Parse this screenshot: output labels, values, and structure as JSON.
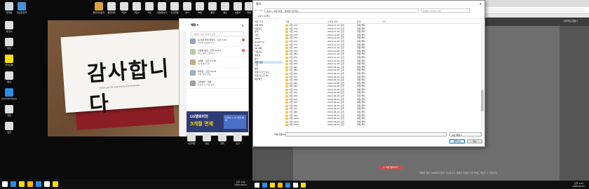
{
  "left_desktop": {
    "icons_top": [
      {
        "label": "휴지통",
        "color": "#cfd8dc"
      },
      {
        "label": "리모트한국",
        "color": "#4a90d9"
      },
      {
        "label": "확인미인문자",
        "color": "#d9a441"
      },
      {
        "label": "통합미래",
        "color": "#e0e0e0"
      },
      {
        "label": "자료1",
        "color": "#e0e0e0"
      },
      {
        "label": "자료2",
        "color": "#e0e0e0"
      },
      {
        "label": "시트",
        "color": "#e0e0e0"
      },
      {
        "label": "정보접속기",
        "color": "#e0e0e0"
      },
      {
        "label": "신규파일",
        "color": "#e0e0e0"
      },
      {
        "label": "문서",
        "color": "#e0e0e0"
      },
      {
        "label": "엑셀",
        "color": "#e0e0e0"
      },
      {
        "label": "통합",
        "color": "#e0e0e0"
      },
      {
        "label": "메모",
        "color": "#e0e0e0"
      },
      {
        "label": "새문서",
        "color": "#e0e0e0"
      },
      {
        "label": "파일",
        "color": "#e0e0e0"
      }
    ],
    "icons_left": [
      {
        "label": "새 문서",
        "color": "#e0e0e0"
      },
      {
        "label": "파일",
        "color": "#e0e0e0"
      },
      {
        "label": "카카오톡",
        "color": "#f9e000"
      },
      {
        "label": "알씨",
        "color": "#e0e0e0"
      },
      {
        "label": "Internet Explorer",
        "color": "#2d8ce5"
      },
      {
        "label": "자료",
        "color": "#e0e0e0"
      },
      {
        "label": "보관",
        "color": "#e0e0e0"
      }
    ],
    "icons_bottom": [
      {
        "label": "사진작업"
      },
      {
        "label": "영상"
      },
      {
        "label": "압축"
      },
      {
        "label": "보관"
      }
    ],
    "wallpaper": {
      "main_text": "감사합니다",
      "sub_text": "thank you for your heart and kindness"
    },
    "taskbar": {
      "time": "오후 1:01",
      "date": "2020-06-01",
      "icons": [
        "#ffffff",
        "#2d8ce5",
        "#f9e000",
        "#ffb900",
        "#2d8ce5",
        "#ffffff",
        "#f9e000"
      ]
    }
  },
  "messenger": {
    "title": "채팅 ▾",
    "search_placeholder": "채팅방 이름, 참여자 검색",
    "rows": [
      {
        "name": "김 비서 업무 담당자",
        "snippet": "사진을 보냈습니다.",
        "time": "오후 1:00",
        "badge": "1",
        "color": "#8aa4c8"
      },
      {
        "name": "홍길동 팀장",
        "snippet": "확인 부탁 드립니다",
        "time": "오후 12:54",
        "badge": "2",
        "color": "#b7c9a8"
      },
      {
        "name": "이대리",
        "snippet": "네 알겠습니다",
        "time": "오전 11:20",
        "badge": "",
        "color": "#c8a98a"
      },
      {
        "name": "박과장",
        "snippet": "파일 전송 완료",
        "time": "오전 10:05",
        "badge": "",
        "color": "#9ab0c0"
      },
      {
        "name": "고객센터",
        "snippet": "문의하신 내용 답변",
        "time": "어제",
        "badge": "",
        "color": "#a0a0a0"
      }
    ],
    "ad": {
      "line1": "LG헬로비전",
      "line2": "3개월 면제",
      "detail": "인터넷 + TV 최대 혜택"
    }
  },
  "browser": {
    "tab_title": "관리자 페이지",
    "url": "관리자 페이지 주소",
    "header_user": "관리자님 환영 ▾",
    "action_button": "+ 파일 첨부하기",
    "note": "파일은 최대 10MB까지 첨부 가능합니다. 첨부한 파일은 수정 후에도 확인할 수 있습니다."
  },
  "file_dialog": {
    "title": "열기",
    "close": "✕",
    "path": "내 PC › 바탕 화면 › 휴대폰사진자료 ›",
    "search_placeholder": "휴대폰사진자료 검색",
    "toolbar": "구성 ▾   새 폴더",
    "tree": [
      {
        "label": "바로 가기",
        "sel": false
      },
      {
        "label": "바탕 화면",
        "sel": false
      },
      {
        "label": "다운로드",
        "sel": false
      },
      {
        "label": "문서",
        "sel": false
      },
      {
        "label": "사진",
        "sel": false
      },
      {
        "label": "2020",
        "sel": false
      },
      {
        "label": "OneDrive",
        "sel": false
      },
      {
        "label": "내 PC",
        "sel": false
      },
      {
        "label": "3D 개체",
        "sel": false
      },
      {
        "label": "다운로드",
        "sel": false
      },
      {
        "label": "동영상",
        "sel": false
      },
      {
        "label": "문서",
        "sel": false
      },
      {
        "label": "바탕 화면",
        "sel": true
      },
      {
        "label": "사진",
        "sel": false
      },
      {
        "label": "음악",
        "sel": false
      },
      {
        "label": "로컬 디스크 (C:)",
        "sel": false
      },
      {
        "label": "로컬 디스크 (D:)",
        "sel": false
      },
      {
        "label": "네트워크",
        "sel": false
      }
    ],
    "columns": [
      "이름",
      "수정한 날짜",
      "유형",
      "크기"
    ],
    "files": [
      {
        "name": "사진 (71)",
        "date": "2019-11-22 오전",
        "type": "파일 폴더",
        "size": ""
      },
      {
        "name": "사진 (72)",
        "date": "2019-11-22 오전",
        "type": "파일 폴더",
        "size": ""
      },
      {
        "name": "사진 (73)",
        "date": "2019-11-22 오전",
        "type": "파일 폴더",
        "size": ""
      },
      {
        "name": "사진 (74)",
        "date": "2019-11-22 오전",
        "type": "파일 폴더",
        "size": ""
      },
      {
        "name": "사진 (75)",
        "date": "2019-11-22 오전",
        "type": "파일 폴더",
        "size": ""
      },
      {
        "name": "사진 (76)",
        "date": "2019-11-22 오전",
        "type": "파일 폴더",
        "size": ""
      },
      {
        "name": "사진 (77)",
        "date": "2019-11-22 오전",
        "type": "파일 폴더",
        "size": ""
      },
      {
        "name": "사진 (78)",
        "date": "2019-11-22 오전",
        "type": "파일 폴더",
        "size": ""
      },
      {
        "name": "사진 (79)",
        "date": "2019-11-22 오전",
        "type": "파일 폴더",
        "size": ""
      },
      {
        "name": "사진 (80)",
        "date": "2019-11-22 오전",
        "type": "파일 폴더",
        "size": ""
      },
      {
        "name": "사진 (81)",
        "date": "2019-11-22 오전",
        "type": "파일 폴더",
        "size": ""
      },
      {
        "name": "사진 (82)",
        "date": "2019-11-22 오전",
        "type": "파일 폴더",
        "size": ""
      },
      {
        "name": "사진 (83)",
        "date": "2019-11-22 오전",
        "type": "파일 폴더",
        "size": ""
      },
      {
        "name": "사진 (84)",
        "date": "2020-02-21 오후",
        "type": "파일 폴더",
        "size": ""
      },
      {
        "name": "사진 (85)",
        "date": "2020-02-21 오후",
        "type": "파일 폴더",
        "size": ""
      },
      {
        "name": "사진 (86)",
        "date": "2020-02-21 오후",
        "type": "파일 폴더",
        "size": ""
      },
      {
        "name": "사진 (87)",
        "date": "2020-02-21 오후",
        "type": "파일 폴더",
        "size": ""
      },
      {
        "name": "사진 (88)",
        "date": "2020-02-21 오후",
        "type": "파일 폴더",
        "size": ""
      },
      {
        "name": "사진 (89)",
        "date": "2020-03-05 오전",
        "type": "파일 폴더",
        "size": ""
      },
      {
        "name": "사진 (90)",
        "date": "2020-03-05 오전",
        "type": "파일 폴더",
        "size": ""
      },
      {
        "name": "사진 (91)",
        "date": "2020-03-05 오전",
        "type": "파일 폴더",
        "size": ""
      },
      {
        "name": "사진 (92)",
        "date": "2020-03-05 오전",
        "type": "파일 폴더",
        "size": ""
      },
      {
        "name": "사진 (93)",
        "date": "2020-03-05 오전",
        "type": "파일 폴더",
        "size": ""
      },
      {
        "name": "사진 (94)",
        "date": "2020-04-10 오후",
        "type": "파일 폴더",
        "size": ""
      },
      {
        "name": "사진 (95)",
        "date": "2020-04-10 오후",
        "type": "파일 폴더",
        "size": ""
      },
      {
        "name": "사진 (96)",
        "date": "2020-04-10 오후",
        "type": "파일 폴더",
        "size": ""
      },
      {
        "name": "사진 (97)",
        "date": "2020-04-10 오후",
        "type": "파일 폴더",
        "size": ""
      },
      {
        "name": "사진 (98)",
        "date": "2020-05-12 오전",
        "type": "파일 폴더",
        "size": ""
      },
      {
        "name": "사진 (99)",
        "date": "2020-05-12 오전",
        "type": "파일 폴더",
        "size": ""
      },
      {
        "name": "사진 (100)",
        "date": "2020-05-12 오전",
        "type": "파일 폴더",
        "size": ""
      },
      {
        "name": "사진 (101)",
        "date": "2020-05-12 오전",
        "type": "파일 폴더",
        "size": ""
      },
      {
        "name": "사진 (102)",
        "date": "2020-05-12 오전",
        "type": "파일 폴더",
        "size": ""
      }
    ],
    "filename_label": "파일 이름(N):",
    "filetype": "모든 파일 ▾",
    "open_button": "열기(O)",
    "cancel_button": "취소"
  },
  "right_taskbar": {
    "time": "오후 1:01",
    "date": "2020-06-01",
    "icons": [
      "#ffffff",
      "#2d8ce5",
      "#f9e000",
      "#ffb900",
      "#2d8ce5",
      "#ffffff",
      "#f9e000"
    ]
  }
}
